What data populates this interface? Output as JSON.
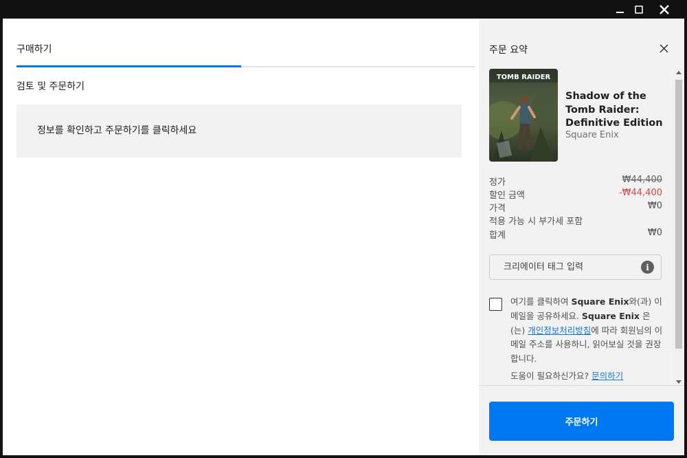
{
  "window": {
    "controls": {
      "minimize_icon": "minimize-icon",
      "maximize_icon": "maximize-icon",
      "close_icon": "close-icon"
    }
  },
  "checkout": {
    "tab_label": "구매하기",
    "section_title": "검토 및 주문하기",
    "info_message": "정보를 확인하고 주문하기를 클릭하세요"
  },
  "summary": {
    "title": "주문 요약",
    "close_icon": "close-icon",
    "cover_art_text": "TOMB RAIDER",
    "game_title": "Shadow of the Tomb Raider: Definitive Edition",
    "publisher": "Square Enix",
    "price_rows": [
      {
        "label": "정가",
        "value": "₩44,400"
      },
      {
        "label": "할인 금액",
        "value": "-₩44,400"
      },
      {
        "label": "가격",
        "value": "₩0"
      },
      {
        "label": "적용 가능 시 부가세 포함",
        "value": ""
      },
      {
        "label": "합계",
        "value": "₩0"
      }
    ],
    "creator_tag_placeholder": "크리에이터 태그 입력",
    "info_icon": "info-icon",
    "consent": {
      "part1": "여기를 클릭하여 ",
      "publisher_bold_1": "Square Enix",
      "part2": "와(과) 이메일을 공유하세요. ",
      "publisher_bold_2": "Square Enix",
      "part3": " 은(는) ",
      "privacy_link": "개인정보처리방침",
      "part4": "에 따라 회원님의 이메일 주소를 사용하니, 읽어보실 것을 권장합니다."
    },
    "help_text": "도움이 필요하신가요?",
    "help_link": "문의하기",
    "order_button": "주문하기"
  },
  "colors": {
    "accent": "#0078f2",
    "discount": "#d64545",
    "tab_underline": "#0f75d8"
  }
}
